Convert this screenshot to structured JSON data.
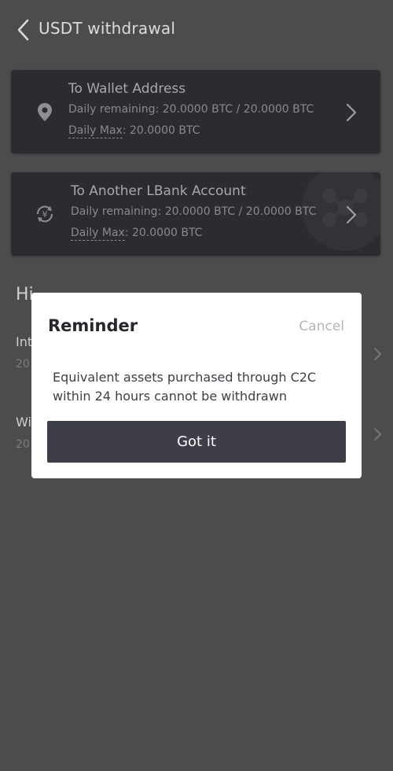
{
  "header": {
    "title": "USDT withdrawal",
    "back_icon": "chevron-left-icon"
  },
  "cards": [
    {
      "title": "To Wallet Address",
      "daily_remaining": "Daily remaining: 20.0000 BTC / 20.0000 BTC",
      "daily_max_label": "Daily Max",
      "daily_max_value": ": 20.0000 BTC",
      "icon": "location-pin-icon"
    },
    {
      "title": "To Another LBank Account",
      "daily_remaining": "Daily remaining: 20.0000 BTC / 20.0000 BTC",
      "daily_max_label": "Daily Max",
      "daily_max_value": ": 20.0000 BTC",
      "icon": "yen-transfer-icon"
    }
  ],
  "history": {
    "title": "Hi",
    "items": [
      {
        "name": "Int",
        "date": "20"
      },
      {
        "name": "Wi",
        "date": "20"
      }
    ]
  },
  "modal": {
    "title": "Reminder",
    "cancel": "Cancel",
    "body": "Equivalent assets purchased through C2C within 24 hours cannot be withdrawn",
    "button": "Got it"
  },
  "colors": {
    "background": "#4c4c4c",
    "card": "#2b2b30",
    "modal_button": "#3e3e49"
  }
}
